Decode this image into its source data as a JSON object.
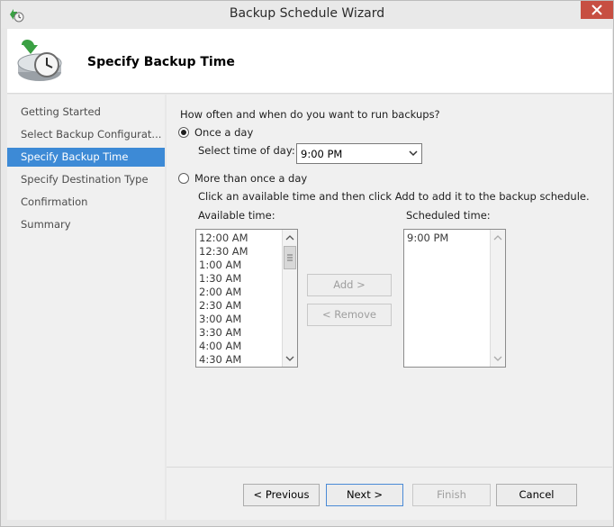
{
  "window": {
    "title": "Backup Schedule Wizard"
  },
  "header": {
    "page_title": "Specify Backup Time"
  },
  "nav": {
    "items": [
      {
        "label": "Getting Started"
      },
      {
        "label": "Select Backup Configurat..."
      },
      {
        "label": "Specify Backup Time"
      },
      {
        "label": "Specify Destination Type"
      },
      {
        "label": "Confirmation"
      },
      {
        "label": "Summary"
      }
    ],
    "active_index": 2
  },
  "main": {
    "question": "How often and when do you want to run backups?",
    "once_a_day": {
      "label": "Once a day",
      "checked": true,
      "time_label": "Select time of day:",
      "time_value": "9:00 PM"
    },
    "more_than_once": {
      "label": "More than once a day",
      "checked": false,
      "instructions": "Click an available time and then click Add to add it to the backup schedule."
    },
    "available": {
      "label": "Available time:",
      "items": [
        "12:00 AM",
        "12:30 AM",
        "1:00 AM",
        "1:30 AM",
        "2:00 AM",
        "2:30 AM",
        "3:00 AM",
        "3:30 AM",
        "4:00 AM",
        "4:30 AM"
      ]
    },
    "scheduled": {
      "label": "Scheduled time:",
      "items": [
        "9:00 PM"
      ]
    },
    "add_button": "Add >",
    "remove_button": "< Remove"
  },
  "footer": {
    "previous": "< Previous",
    "next": "Next >",
    "finish": "Finish",
    "cancel": "Cancel"
  },
  "colors": {
    "active_nav": "#3d8ad6",
    "close_button": "#c74f42"
  },
  "icons": [
    "backup-schedule-icon",
    "close-icon",
    "wizard-backup-clock-icon",
    "chevron-down-icon",
    "scroll-up-icon",
    "scroll-down-icon"
  ]
}
